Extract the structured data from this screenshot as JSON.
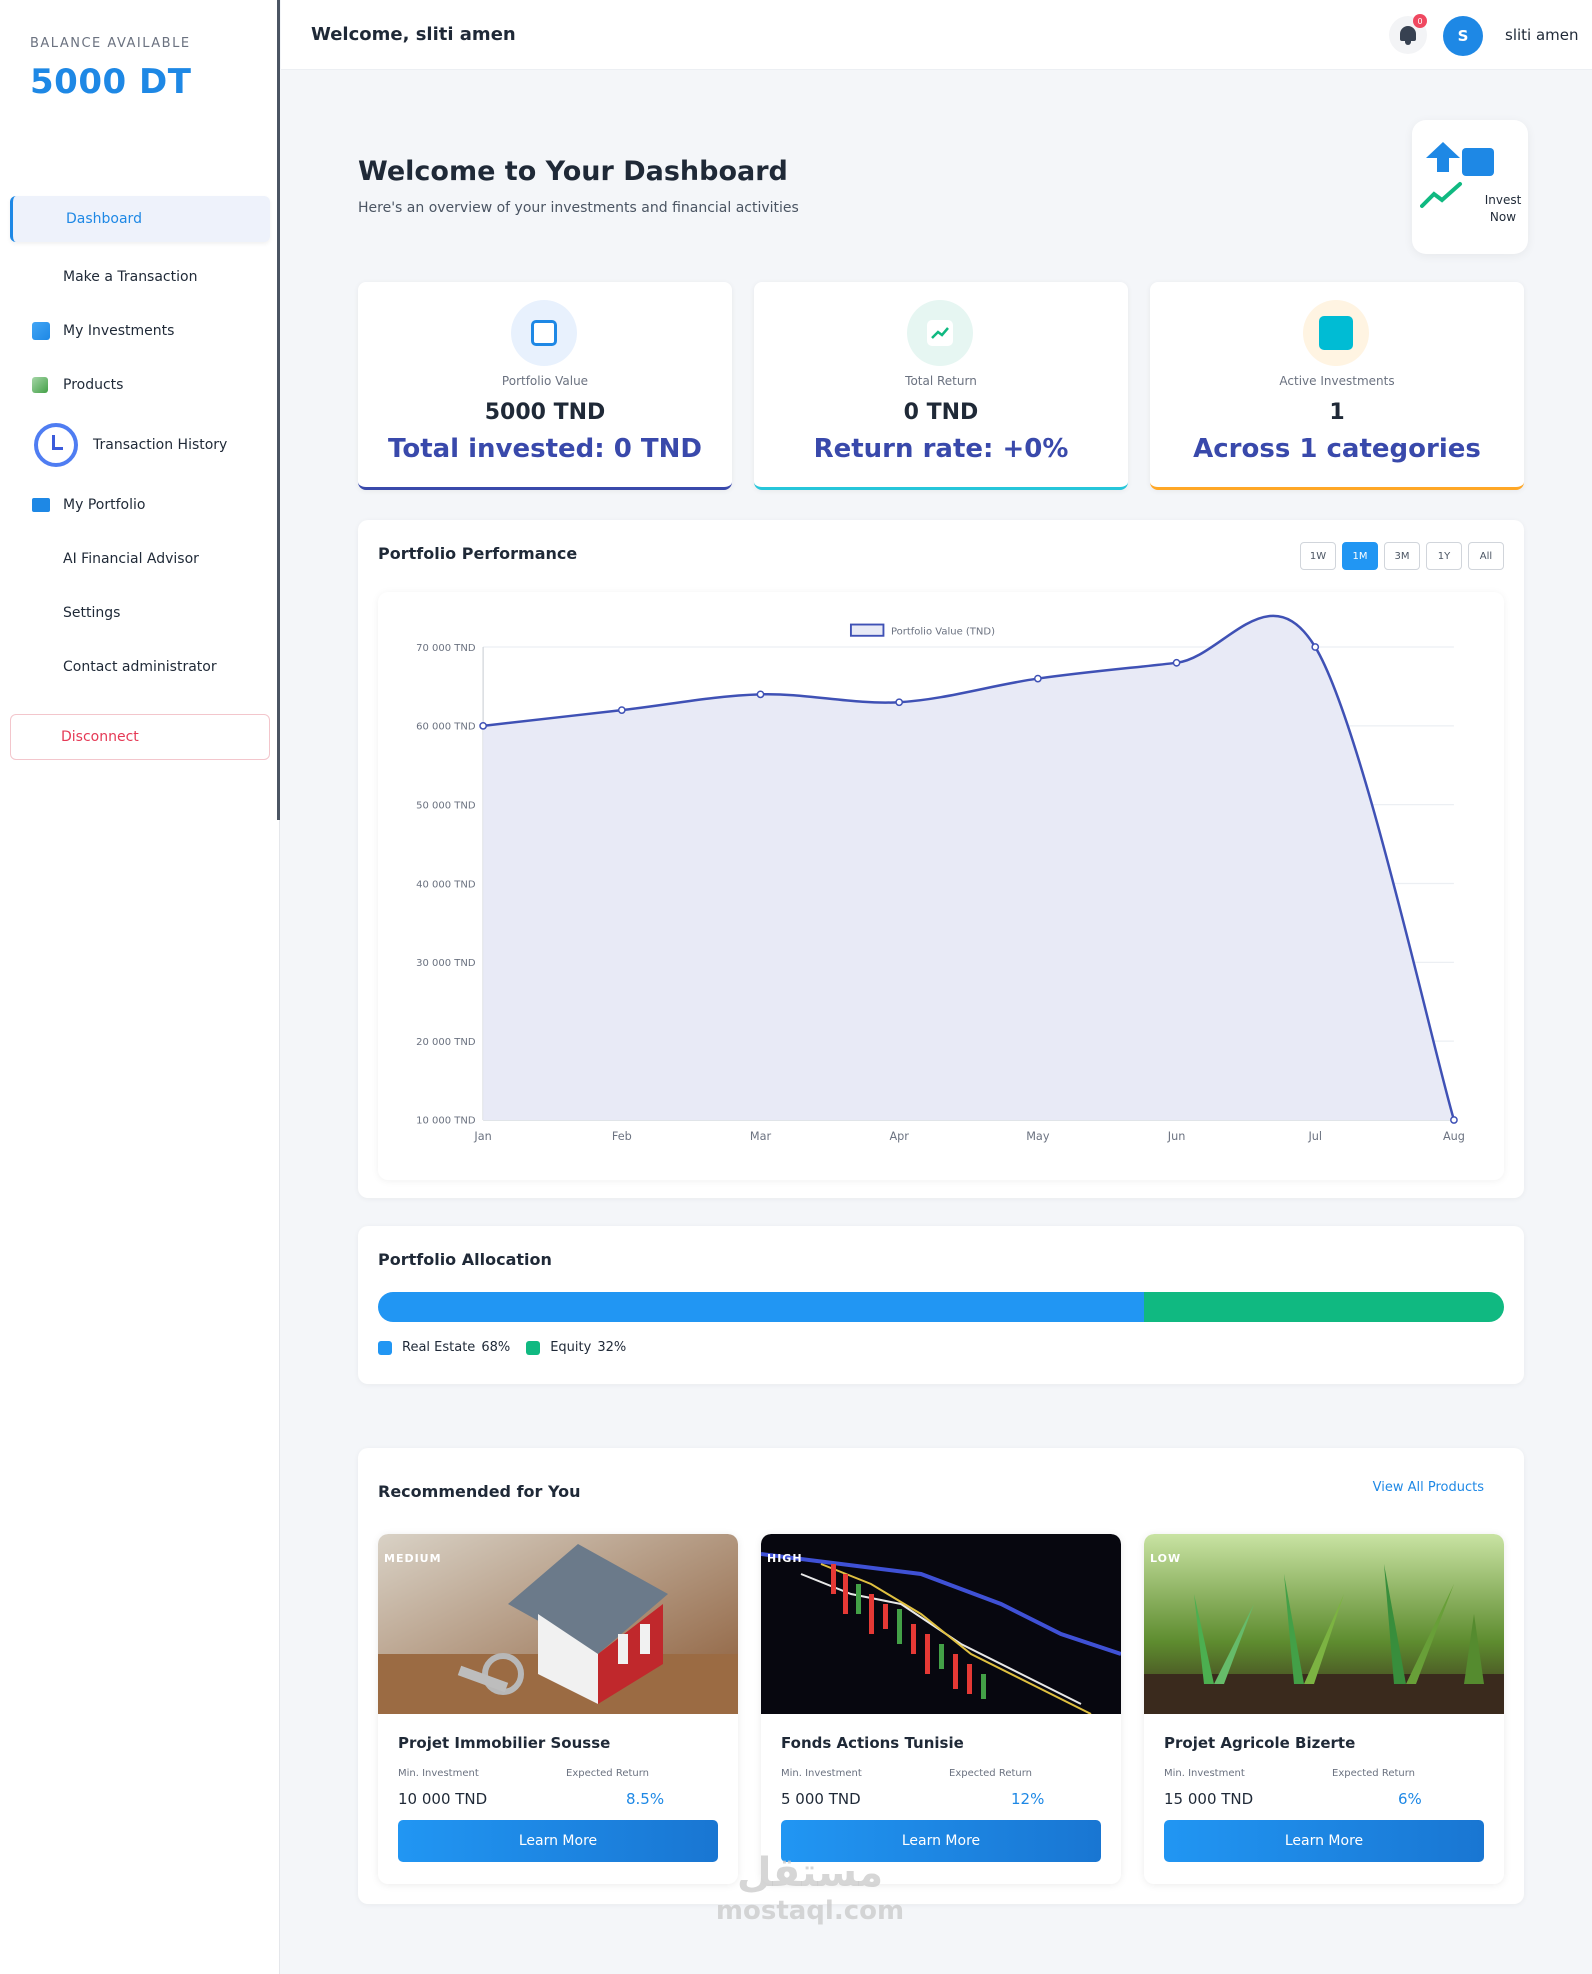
{
  "sidebar": {
    "balance_label": "BALANCE AVAILABLE",
    "balance_value": "5000 DT",
    "items": [
      {
        "label": "Dashboard",
        "active": true
      },
      {
        "label": "Make a Transaction"
      },
      {
        "label": "My Investments",
        "icon": "investments-icon"
      },
      {
        "label": "Products",
        "icon": "chart-bar-icon"
      },
      {
        "label": "Transaction History",
        "icon": "history-icon"
      },
      {
        "label": "My Portfolio",
        "icon": "portfolio-icon"
      },
      {
        "label": "AI Financial Advisor"
      },
      {
        "label": "Settings"
      },
      {
        "label": "Contact administrator"
      }
    ],
    "disconnect_label": "Disconnect"
  },
  "topbar": {
    "welcome": "Welcome, sliti amen",
    "notification_count": "0",
    "avatar_initial": "S",
    "username": "sliti amen"
  },
  "main": {
    "title": "Welcome to Your Dashboard",
    "subtitle": "Here's an overview of your investments and financial activities",
    "invest_now_label": "Invest Now"
  },
  "stats": [
    {
      "label": "Portfolio Value",
      "value": "5000 TND",
      "sub": "Total invested: 0 TND",
      "icon": "wallet-icon",
      "accent": "#3949ab"
    },
    {
      "label": "Total Return",
      "value": "0 TND",
      "sub": "Return rate: +0%",
      "icon": "trend-up-icon",
      "accent": "#26c6da"
    },
    {
      "label": "Active Investments",
      "value": "1",
      "sub": "Across 1 categories",
      "icon": "briefcase-icon",
      "accent": "#ffa726"
    }
  ],
  "performance": {
    "title": "Portfolio Performance",
    "ranges": [
      "1W",
      "1M",
      "3M",
      "1Y",
      "All"
    ],
    "active_range": "1M"
  },
  "chart_data": {
    "type": "area",
    "categories": [
      "Jan",
      "Feb",
      "Mar",
      "Apr",
      "May",
      "Jun",
      "Jul",
      "Aug"
    ],
    "series": [
      {
        "name": "Portfolio Value (TND)",
        "values": [
          60000,
          62000,
          64000,
          63000,
          66000,
          68000,
          70000,
          10000
        ]
      }
    ],
    "yticks": [
      70000,
      60000,
      50000,
      40000,
      30000,
      20000,
      10000
    ],
    "ytick_labels": [
      "70 000 TND",
      "60 000 TND",
      "50 000 TND",
      "40 000 TND",
      "30 000 TND",
      "20 000 TND",
      "10 000 TND"
    ],
    "ylim": [
      10000,
      70000
    ],
    "grid": true,
    "legend_position": "top-center",
    "color": "#3f51b5",
    "fill": "#e8eaf6"
  },
  "allocation": {
    "title": "Portfolio Allocation",
    "segments": [
      {
        "name": "Real Estate",
        "percent": 68,
        "pct_label": "68%",
        "color": "#2196f3"
      },
      {
        "name": "Equity",
        "percent": 32,
        "pct_label": "32%",
        "color": "#10b981"
      }
    ]
  },
  "recommended": {
    "title": "Recommended for You",
    "view_all": "View All Products",
    "min_label": "Min. Investment",
    "return_label": "Expected Return",
    "learn_more": "Learn More",
    "products": [
      {
        "name": "Projet Immobilier Sousse",
        "risk": "MEDIUM",
        "min": "10 000 TND",
        "return": "8.5%"
      },
      {
        "name": "Fonds Actions Tunisie",
        "risk": "HIGH",
        "min": "5 000 TND",
        "return": "12%"
      },
      {
        "name": "Projet Agricole Bizerte",
        "risk": "LOW",
        "min": "15 000 TND",
        "return": "6%"
      }
    ]
  },
  "watermark": {
    "logo": "مستقل",
    "text": "mostaql.com"
  }
}
